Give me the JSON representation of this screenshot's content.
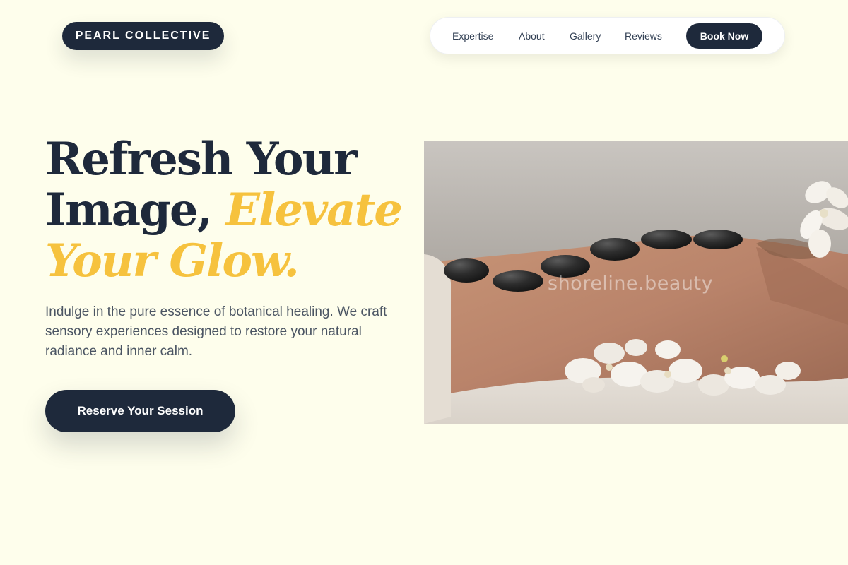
{
  "brand": {
    "name": "PEARL COLLECTIVE"
  },
  "nav": {
    "items": [
      {
        "label": "Expertise"
      },
      {
        "label": "About"
      },
      {
        "label": "Gallery"
      },
      {
        "label": "Reviews"
      }
    ],
    "cta_label": "Book Now"
  },
  "hero": {
    "title_line1": "Refresh Your",
    "title_line2_plain": "Image,",
    "title_line2_accent": "Elevate",
    "title_line3_accent": "Your Glow.",
    "description": "Indulge in the pure essence of botanical healing. We craft sensory experiences designed to restore your natural radiance and inner calm.",
    "cta_label": "Reserve Your Session",
    "image_watermark": "shoreline.beauty"
  },
  "colors": {
    "background": "#fefeec",
    "primary_dark": "#1e293b",
    "accent_gold": "#f6c23e",
    "body_text": "#4b5563"
  }
}
